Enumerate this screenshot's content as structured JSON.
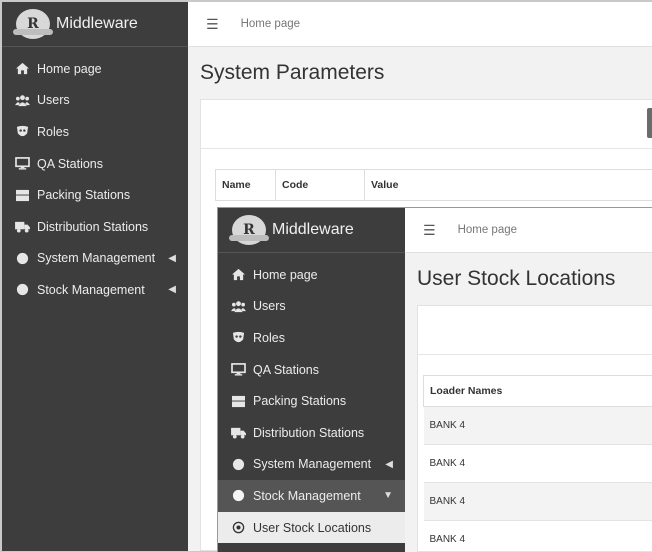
{
  "brand": "Middleware",
  "logo_text": "R",
  "nav_items": [
    {
      "label": "Home page",
      "icon": "home-icon"
    },
    {
      "label": "Users",
      "icon": "users-icon"
    },
    {
      "label": "Roles",
      "icon": "mask-icon"
    },
    {
      "label": "QA Stations",
      "icon": "monitor-icon"
    },
    {
      "label": "Packing Stations",
      "icon": "box-icon"
    },
    {
      "label": "Distribution Stations",
      "icon": "truck-icon"
    },
    {
      "label": "System Management",
      "icon": "circle-icon"
    },
    {
      "label": "Stock Management",
      "icon": "circle-icon"
    }
  ],
  "submenu_item": {
    "label": "User Stock Locations",
    "icon": "target-icon"
  },
  "breadcrumb": "Home page",
  "back_window": {
    "title": "System Parameters",
    "columns": [
      "Name",
      "Code",
      "Value"
    ]
  },
  "front_window": {
    "title": "User Stock Locations",
    "columns": [
      "Loader Names"
    ],
    "rows": [
      "BANK 4",
      "BANK 4",
      "BANK 4",
      "BANK 4"
    ]
  }
}
